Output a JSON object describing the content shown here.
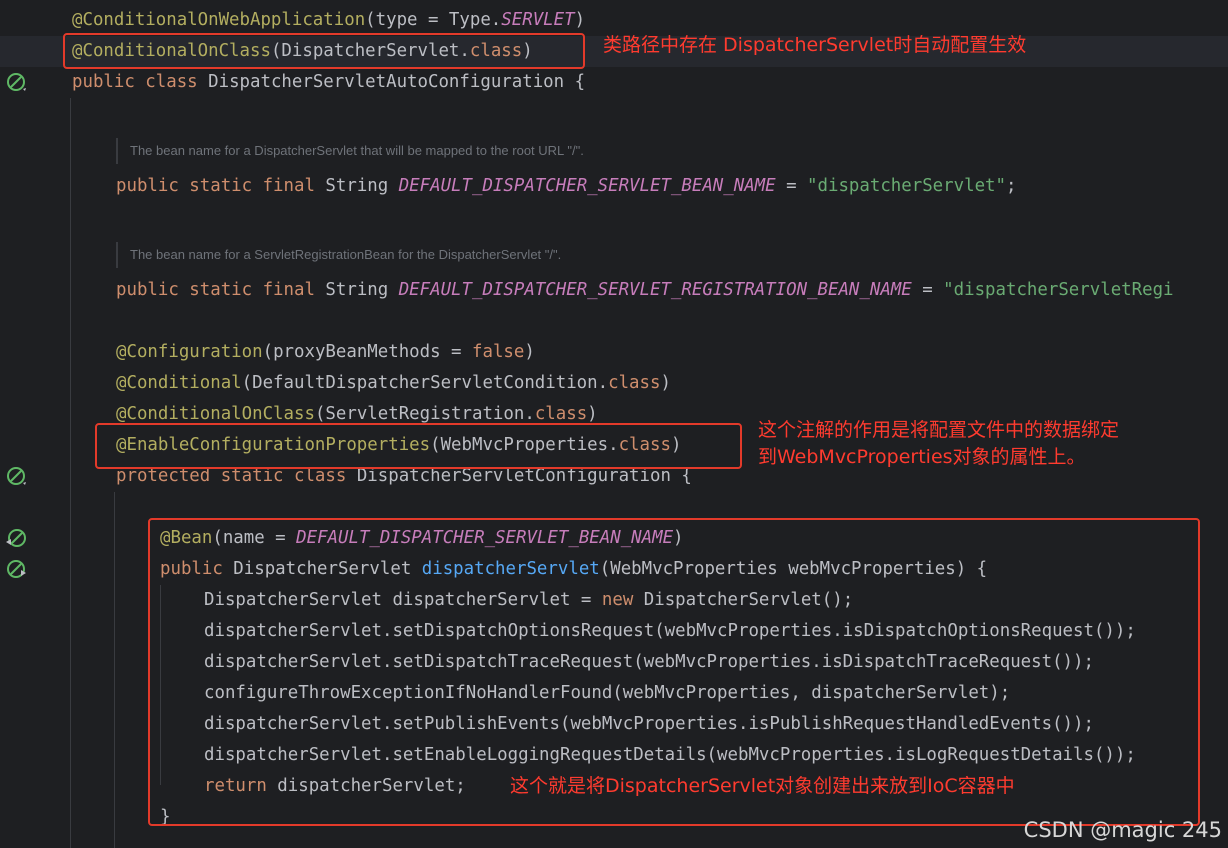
{
  "code": {
    "l1": {
      "ann": "@ConditionalOnWebApplication",
      "a": "(type = Type.",
      "b": "SERVLET",
      "c": ")"
    },
    "l2": {
      "ann": "@ConditionalOnClass",
      "a": "(DispatcherServlet.",
      "b": "class",
      "c": ")"
    },
    "l3": {
      "kw": "public class ",
      "a": "DispatcherServletAutoConfiguration {"
    },
    "doc1": "The bean name for a DispatcherServlet that will be mapped to the root URL \"/\".",
    "l4": {
      "kw": "public static final ",
      "a": "String ",
      "b": "DEFAULT_DISPATCHER_SERVLET_BEAN_NAME",
      "c": " = ",
      "d": "\"dispatcherServlet\"",
      "e": ";"
    },
    "doc2": "The bean name for a ServletRegistrationBean for the DispatcherServlet \"/\".",
    "l5": {
      "kw": "public static final ",
      "a": "String ",
      "b": "DEFAULT_DISPATCHER_SERVLET_REGISTRATION_BEAN_NAME",
      "c": " = ",
      "d": "\"dispatcherServletRegi"
    },
    "l6": {
      "ann": "@Configuration",
      "a": "(proxyBeanMethods = ",
      "b": "false",
      "c": ")"
    },
    "l7": {
      "ann": "@Conditional",
      "a": "(DefaultDispatcherServletCondition.",
      "b": "class",
      "c": ")"
    },
    "l8": {
      "ann": "@ConditionalOnClass",
      "a": "(ServletRegistration.",
      "b": "class",
      "c": ")"
    },
    "l9": {
      "ann": "@EnableConfigurationProperties",
      "a": "(WebMvcProperties.",
      "b": "class",
      "c": ")"
    },
    "l10": {
      "kw": "protected static class ",
      "a": "DispatcherServletConfiguration {"
    },
    "l11": {
      "ann": "@Bean",
      "a": "(name = ",
      "b": "DEFAULT_DISPATCHER_SERVLET_BEAN_NAME",
      "c": ")"
    },
    "l12": {
      "kw": "public ",
      "a": "DispatcherServlet ",
      "fn": "dispatcherServlet",
      "b": "(WebMvcProperties webMvcProperties) {"
    },
    "l13": {
      "a": "DispatcherServlet dispatcherServlet = ",
      "kw": "new ",
      "b": "DispatcherServlet();"
    },
    "l14": "dispatcherServlet.setDispatchOptionsRequest(webMvcProperties.isDispatchOptionsRequest());",
    "l15": "dispatcherServlet.setDispatchTraceRequest(webMvcProperties.isDispatchTraceRequest());",
    "l16": "configureThrowExceptionIfNoHandlerFound(webMvcProperties, dispatcherServlet);",
    "l17": "dispatcherServlet.setPublishEvents(webMvcProperties.isPublishRequestHandledEvents());",
    "l18": "dispatcherServlet.setEnableLoggingRequestDetails(webMvcProperties.isLogRequestDetails());",
    "l19": {
      "kw": "return ",
      "a": "dispatcherServlet;"
    },
    "l20": "}"
  },
  "notes": {
    "n1": "类路径中存在 DispatcherServlet时自动配置生效",
    "n2a": "这个注解的作用是将配置文件中的数据绑定",
    "n2b": "到WebMvcProperties对象的属性上。",
    "n3": "这个就是将DispatcherServlet对象创建出来放到IoC容器中"
  },
  "watermark": "CSDN @magic 245",
  "colors": {
    "background": "#1e1f22",
    "keyword": "#cf8e6d",
    "annotation": "#b3ae60",
    "constant": "#c77dbb",
    "string": "#6aab73",
    "function": "#56a8f5",
    "highlight": "#e33a2a"
  },
  "gutter_icons": [
    "bean-icon",
    "bean-icon",
    "bean-navigate-icon",
    "bean-navigate-icon"
  ]
}
